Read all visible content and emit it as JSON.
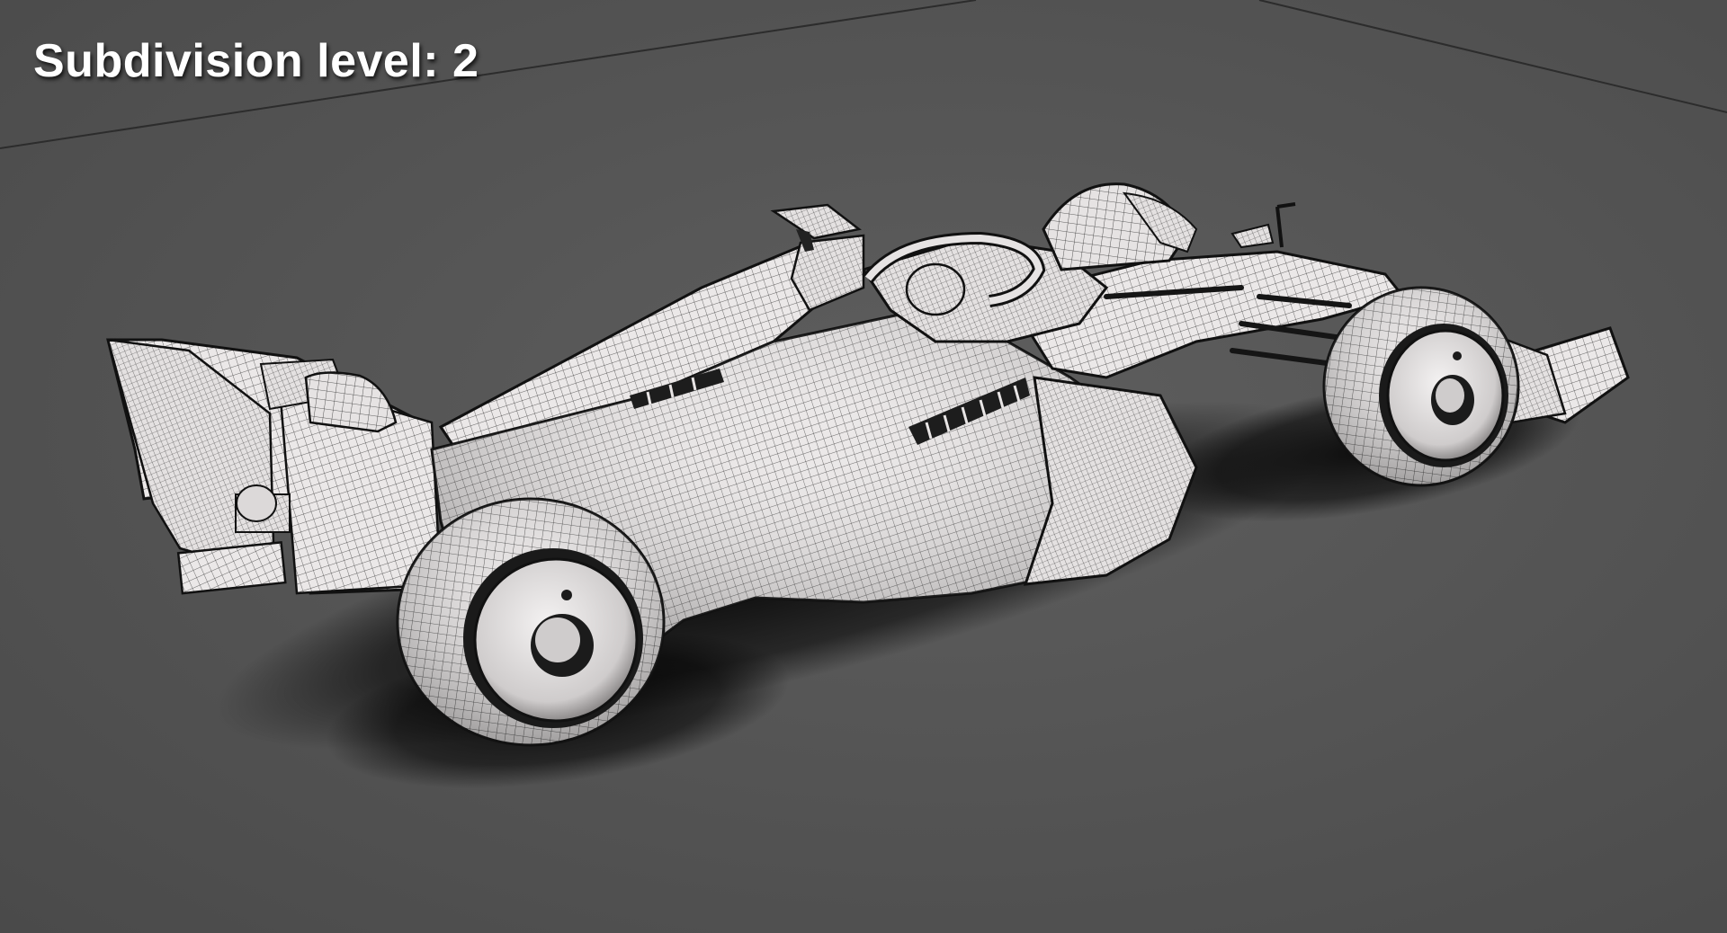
{
  "overlay": {
    "subdivision_label": "Subdivision level: 2"
  },
  "scene": {
    "subject": "race-car-wireframe-render",
    "colors": {
      "ground": "#555555",
      "surface": "#e9e6e6",
      "wire": "#2a2a2a",
      "shadow": "#1a1a1a",
      "label_text": "#ffffff"
    }
  }
}
